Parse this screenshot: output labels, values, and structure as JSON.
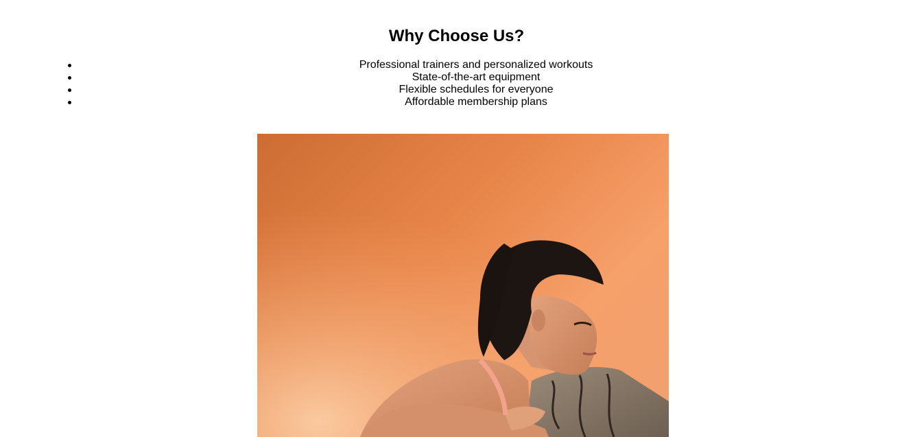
{
  "section": {
    "title": "Why Choose Us?",
    "features": [
      "Professional trainers and personalized workouts",
      "State-of-the-art equipment",
      "Flexible schedules for everyone",
      "Affordable membership plans"
    ]
  },
  "colors": {
    "background": "#ffffff",
    "text": "#000000",
    "photo_backdrop": "#e8864a"
  }
}
